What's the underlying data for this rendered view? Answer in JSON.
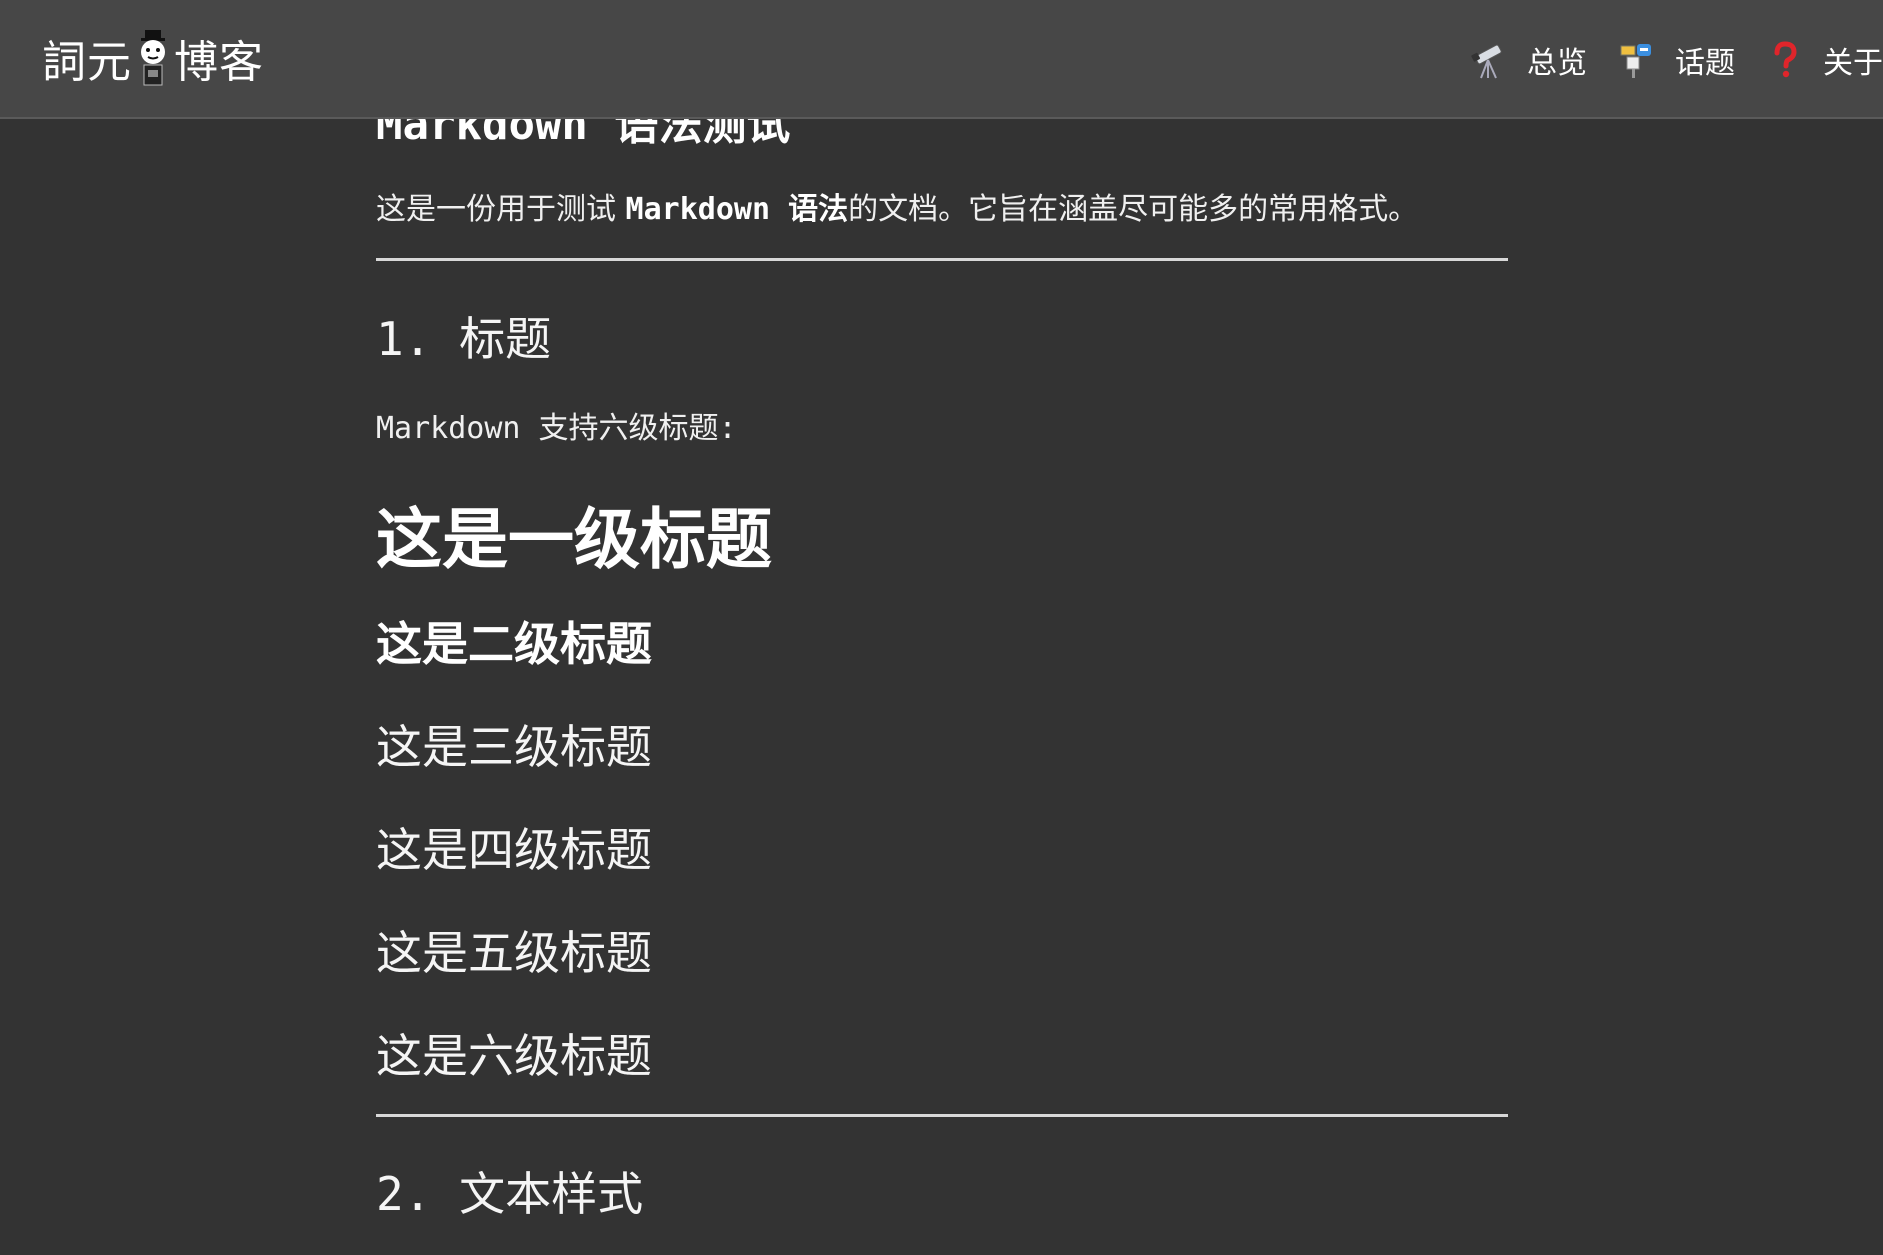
{
  "brand": {
    "name_left": "詞元",
    "name_right": "博客"
  },
  "nav": {
    "items": [
      {
        "label": "总览",
        "icon": "telescope-icon"
      },
      {
        "label": "话题",
        "icon": "bulletin-board-icon"
      },
      {
        "label": "关于",
        "icon": "question-mark-icon"
      }
    ]
  },
  "article": {
    "title": "Markdown 语法测试",
    "intro_before": "这是一份用于测试 ",
    "intro_bold": "Markdown 语法",
    "intro_after": "的文档。它旨在涵盖尽可能多的常用格式。",
    "section1_title": "1. 标题",
    "section1_text": "Markdown 支持六级标题:",
    "h1": "这是一级标题",
    "h2": "这是二级标题",
    "h3": "这是三级标题",
    "h4": "这是四级标题",
    "h5": "这是五级标题",
    "h6": "这是六级标题",
    "section2_title": "2. 文本样式"
  },
  "colors": {
    "background": "#333333",
    "topbar": "#474747",
    "text": "#f2f2f2",
    "rule": "#d8d8d8",
    "question_icon": "#e0252b"
  }
}
